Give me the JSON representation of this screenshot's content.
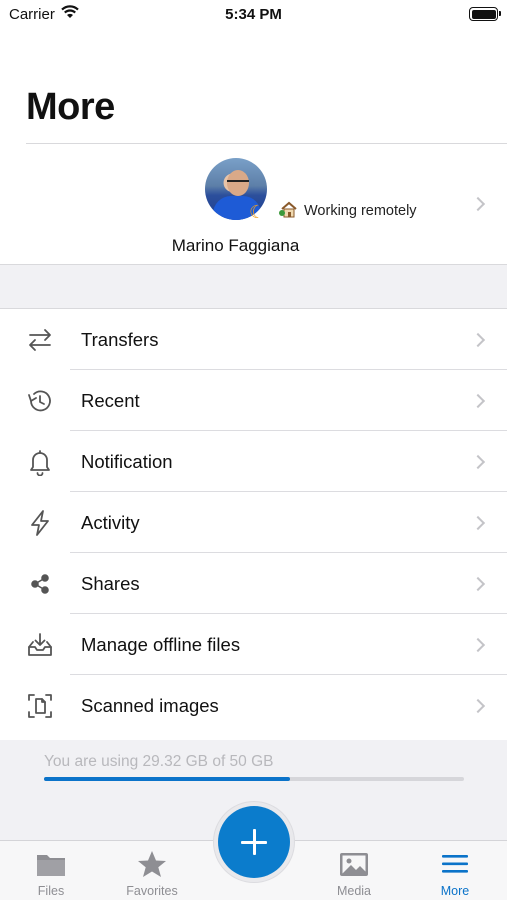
{
  "status_bar": {
    "carrier": "Carrier",
    "time": "5:34 PM"
  },
  "page": {
    "title": "More"
  },
  "profile": {
    "name": "Marino Faggiana",
    "status_text": "Working remotely",
    "status_icon": "house-with-garden-icon",
    "presence_icon": "moon-icon"
  },
  "menu": {
    "items": [
      {
        "label": "Transfers",
        "icon": "transfers-icon"
      },
      {
        "label": "Recent",
        "icon": "history-icon"
      },
      {
        "label": "Notification",
        "icon": "bell-icon"
      },
      {
        "label": "Activity",
        "icon": "lightning-icon"
      },
      {
        "label": "Shares",
        "icon": "share-icon"
      },
      {
        "label": "Manage offline files",
        "icon": "offline-download-icon"
      },
      {
        "label": "Scanned images",
        "icon": "scan-document-icon"
      }
    ]
  },
  "storage": {
    "usage_text": "You are using 29.32 GB of 50 GB",
    "used_fraction": 0.5864
  },
  "tab_bar": {
    "tabs": [
      {
        "label": "Files",
        "icon": "folder-icon",
        "active": false
      },
      {
        "label": "Favorites",
        "icon": "star-icon",
        "active": false
      },
      {
        "label": "Media",
        "icon": "image-icon",
        "active": false
      },
      {
        "label": "More",
        "icon": "menu-icon",
        "active": true
      }
    ],
    "fab_icon": "plus-icon"
  },
  "colors": {
    "accent": "#0b73c9",
    "fab": "#0b7ccc",
    "grouped_background": "#f1f1f4",
    "separator": "#d9d9dc",
    "inactive_tab": "#8e8e93"
  }
}
